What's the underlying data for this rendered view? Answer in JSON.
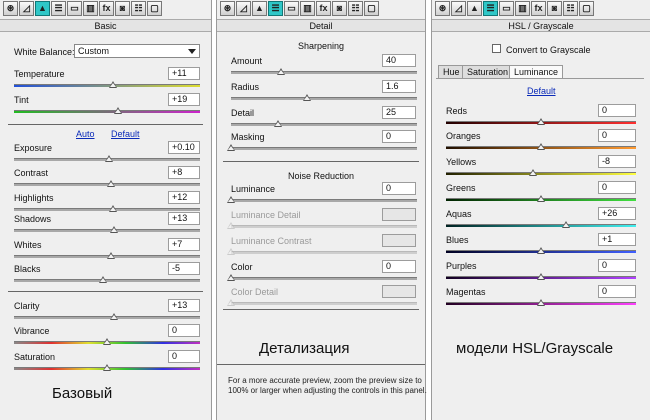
{
  "colors": {
    "panel_bg": "#efefef",
    "active_tool": "#2fc7c7",
    "link": "#0a2ab8"
  },
  "toolbar_icons": [
    "aperture-icon",
    "tone-curve-icon",
    "detail-triangle-icon",
    "hsl-icon",
    "split-tone-icon",
    "lens-icon",
    "fx-icon",
    "camera-icon",
    "presets-icon",
    "snapshots-icon"
  ],
  "toolbar_glyphs": [
    "⊛",
    "◿",
    "▲",
    "☰",
    "▭",
    "▥",
    "fx",
    "◙",
    "☷",
    "▢"
  ],
  "basic": {
    "title": "Basic",
    "white_balance_label": "White Balance:",
    "white_balance_value": "Custom",
    "auto_label": "Auto",
    "default_label": "Default",
    "sliders": [
      {
        "label": "Temperature",
        "value": "+11",
        "level": 0.53,
        "gradient": "temperature"
      },
      {
        "label": "Tint",
        "value": "+19",
        "level": 0.56,
        "gradient": "tint"
      },
      {
        "label": "Exposure",
        "value": "+0.10",
        "level": 0.51,
        "gradient": "none"
      },
      {
        "label": "Contrast",
        "value": "+8",
        "level": 0.52,
        "gradient": "none"
      },
      {
        "label": "Highlights",
        "value": "+12",
        "level": 0.53,
        "gradient": "none"
      },
      {
        "label": "Shadows",
        "value": "+13",
        "level": 0.54,
        "gradient": "none"
      },
      {
        "label": "Whites",
        "value": "+7",
        "level": 0.52,
        "gradient": "none"
      },
      {
        "label": "Blacks",
        "value": "-5",
        "level": 0.48,
        "gradient": "none"
      },
      {
        "label": "Clarity",
        "value": "+13",
        "level": 0.54,
        "gradient": "none"
      },
      {
        "label": "Vibrance",
        "value": "0",
        "level": 0.5,
        "gradient": "vibrance"
      },
      {
        "label": "Saturation",
        "value": "0",
        "level": 0.5,
        "gradient": "saturation"
      }
    ],
    "caption": "Базовый"
  },
  "detail": {
    "title": "Detail",
    "sharpening_title": "Sharpening",
    "sharpening": [
      {
        "label": "Amount",
        "value": "40",
        "level": 0.27,
        "disabled": false
      },
      {
        "label": "Radius",
        "value": "1.6",
        "level": 0.41,
        "disabled": false
      },
      {
        "label": "Detail",
        "value": "25",
        "level": 0.25,
        "disabled": false
      },
      {
        "label": "Masking",
        "value": "0",
        "level": 0.0,
        "disabled": false
      }
    ],
    "noise_title": "Noise Reduction",
    "noise": [
      {
        "label": "Luminance",
        "value": "0",
        "level": 0.0,
        "disabled": false
      },
      {
        "label": "Luminance Detail",
        "value": "",
        "level": 0.0,
        "disabled": true
      },
      {
        "label": "Luminance Contrast",
        "value": "",
        "level": 0.0,
        "disabled": true
      },
      {
        "label": "Color",
        "value": "0",
        "level": 0.0,
        "disabled": false
      },
      {
        "label": "Color Detail",
        "value": "",
        "level": 0.0,
        "disabled": true
      }
    ],
    "caption": "Детализация",
    "note": "For a more accurate preview, zoom the preview size to 100% or larger when adjusting the controls in this panel."
  },
  "hsl": {
    "title": "HSL / Grayscale",
    "convert_label": "Convert to Grayscale",
    "tabs": [
      "Hue",
      "Saturation",
      "Luminance"
    ],
    "active_tab": "Luminance",
    "default_label": "Default",
    "sliders": [
      {
        "label": "Reds",
        "value": "0",
        "level": 0.5,
        "gradient": "reds"
      },
      {
        "label": "Oranges",
        "value": "0",
        "level": 0.5,
        "gradient": "oranges"
      },
      {
        "label": "Yellows",
        "value": "-8",
        "level": 0.46,
        "gradient": "yellows"
      },
      {
        "label": "Greens",
        "value": "0",
        "level": 0.5,
        "gradient": "greens"
      },
      {
        "label": "Aquas",
        "value": "+26",
        "level": 0.63,
        "gradient": "aquas"
      },
      {
        "label": "Blues",
        "value": "+1",
        "level": 0.5,
        "gradient": "blues"
      },
      {
        "label": "Purples",
        "value": "0",
        "level": 0.5,
        "gradient": "purples"
      },
      {
        "label": "Magentas",
        "value": "0",
        "level": 0.5,
        "gradient": "magentas"
      }
    ],
    "caption": "модели HSL/Grayscale"
  }
}
